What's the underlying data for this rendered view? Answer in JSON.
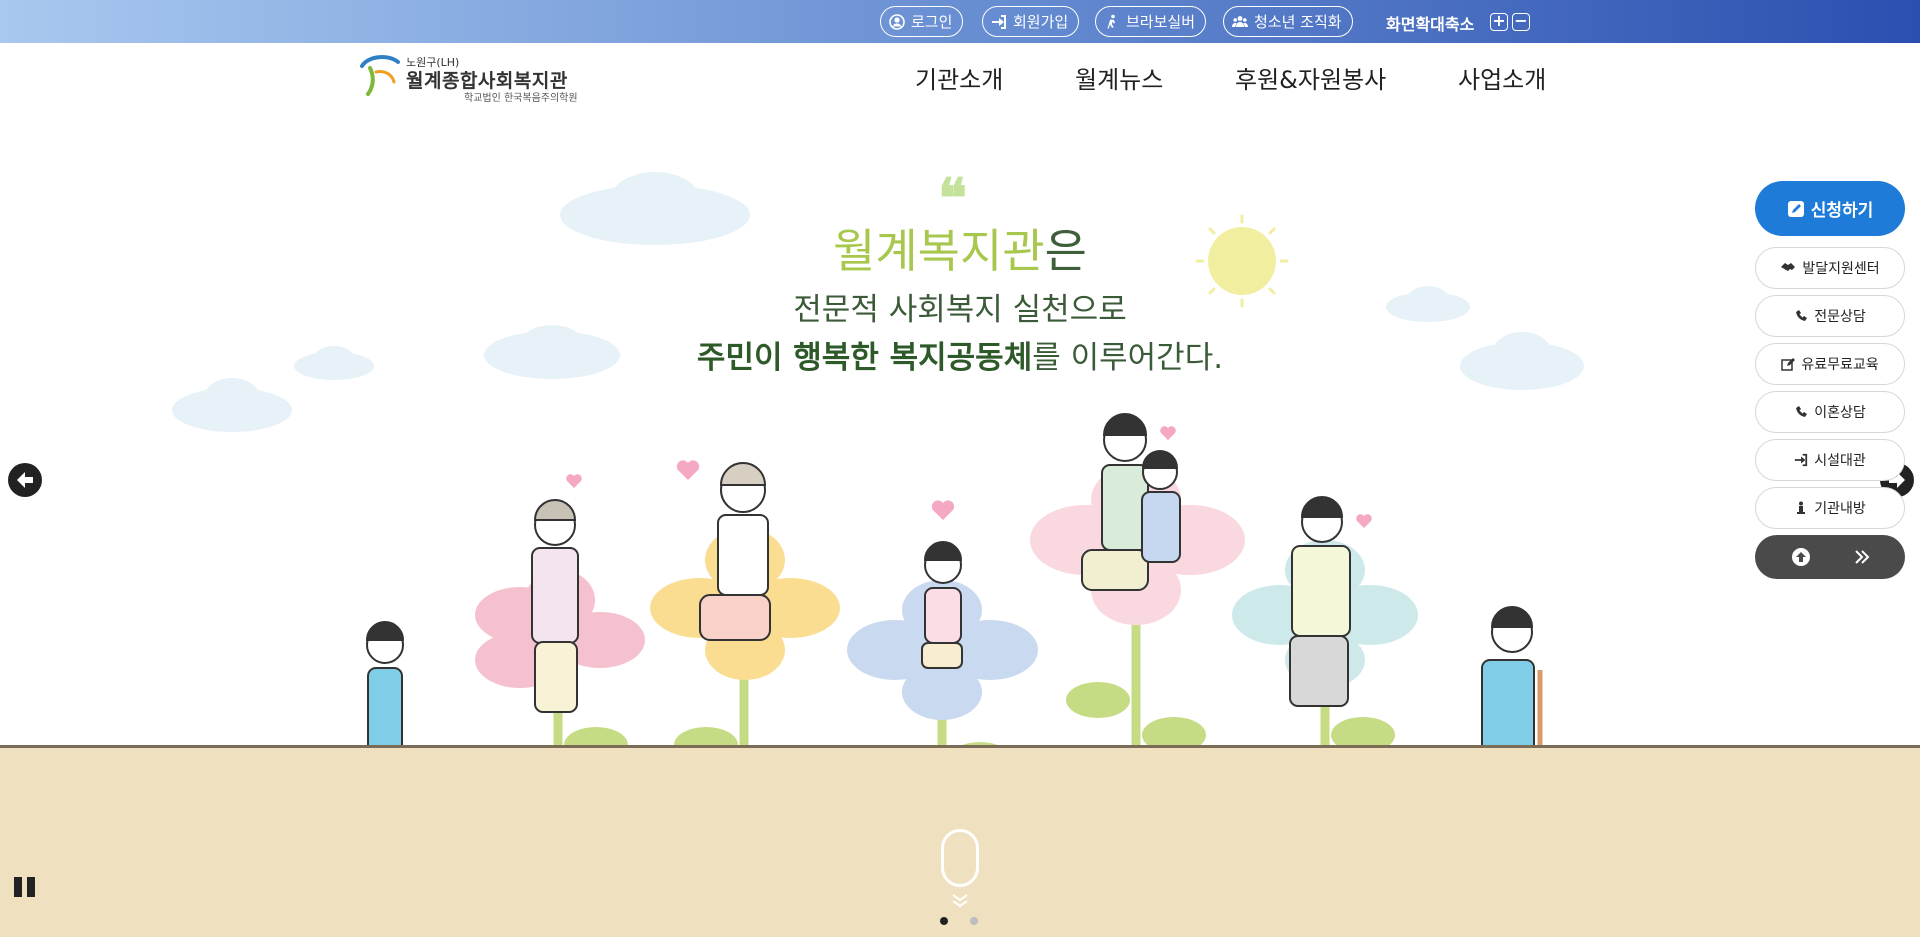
{
  "topbar": {
    "links": [
      {
        "label": "로그인",
        "icon": "user-circle-icon"
      },
      {
        "label": "회원가입",
        "icon": "sign-in-icon"
      },
      {
        "label": "브라보실버",
        "icon": "walking-person-icon"
      },
      {
        "label": "청소년 조직화",
        "icon": "group-icon"
      }
    ],
    "zoom_label": "화면확대축소",
    "zoom_in": "+",
    "zoom_out": "−"
  },
  "logo": {
    "small": "노원구(LH)",
    "main": "월계종합사회복지관",
    "sub": "학교법인 한국복음주의학원"
  },
  "nav": [
    "기관소개",
    "월계뉴스",
    "후원&자원봉사",
    "사업소개"
  ],
  "hero": {
    "quote_mark": "❝",
    "title_highlight": "월계복지관",
    "title_rest": "은",
    "line2": "전문적 사회복지 실천으로",
    "line3_bold": "주민이 행복한 복지공동체",
    "line3_rest": "를 이루어간다."
  },
  "quick_menu": {
    "apply": "신청하기",
    "items": [
      {
        "label": "발달지원센터",
        "icon": "handshake-icon"
      },
      {
        "label": "전문상담",
        "icon": "phone-volume-icon"
      },
      {
        "label": "유료무료교육",
        "icon": "edit-icon"
      },
      {
        "label": "이혼상담",
        "icon": "phone-icon"
      },
      {
        "label": "시설대관",
        "icon": "sign-in-icon"
      },
      {
        "label": "기관내방",
        "icon": "walk-icon"
      }
    ]
  },
  "slider": {
    "active_index": 0,
    "count": 2
  },
  "colors": {
    "accent_green": "#a7c84d",
    "text_green": "#3b5a38",
    "apply_blue": "#1e7bd8",
    "ground": "#efe1c0"
  }
}
